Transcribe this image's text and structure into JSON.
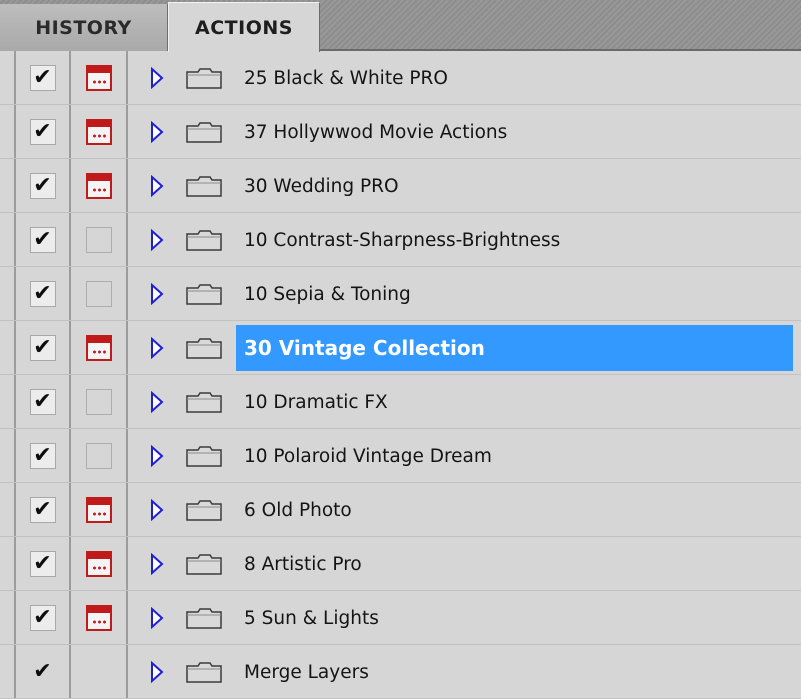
{
  "tabs": {
    "history": "HISTORY",
    "actions": "ACTIONS"
  },
  "colors": {
    "selection": "#3399ff",
    "dialog_toggle": "#c01a1a",
    "expander": "#1f1fd0"
  },
  "actions": [
    {
      "name": "25 Black & White PRO",
      "checked": true,
      "dialog": "on"
    },
    {
      "name": "37 Hollywwod Movie Actions",
      "checked": true,
      "dialog": "on"
    },
    {
      "name": "30 Wedding PRO",
      "checked": true,
      "dialog": "on"
    },
    {
      "name": "10 Contrast-Sharpness-Brightness",
      "checked": true,
      "dialog": "off"
    },
    {
      "name": "10 Sepia & Toning",
      "checked": true,
      "dialog": "off"
    },
    {
      "name": "30 Vintage Collection",
      "checked": true,
      "dialog": "on",
      "selected": true
    },
    {
      "name": "10 Dramatic FX",
      "checked": true,
      "dialog": "off"
    },
    {
      "name": "10 Polaroid Vintage Dream",
      "checked": true,
      "dialog": "off"
    },
    {
      "name": "6 Old Photo",
      "checked": true,
      "dialog": "on"
    },
    {
      "name": "8 Artistic Pro",
      "checked": true,
      "dialog": "on"
    },
    {
      "name": "5 Sun & Lights",
      "checked": true,
      "dialog": "on"
    },
    {
      "name": "Merge Layers",
      "checked": true,
      "dialog": "none"
    }
  ],
  "icons": {
    "check": "check-icon",
    "dialog": "dialog-toggle-icon",
    "expander": "expand-triangle-icon",
    "folder": "folder-icon"
  }
}
